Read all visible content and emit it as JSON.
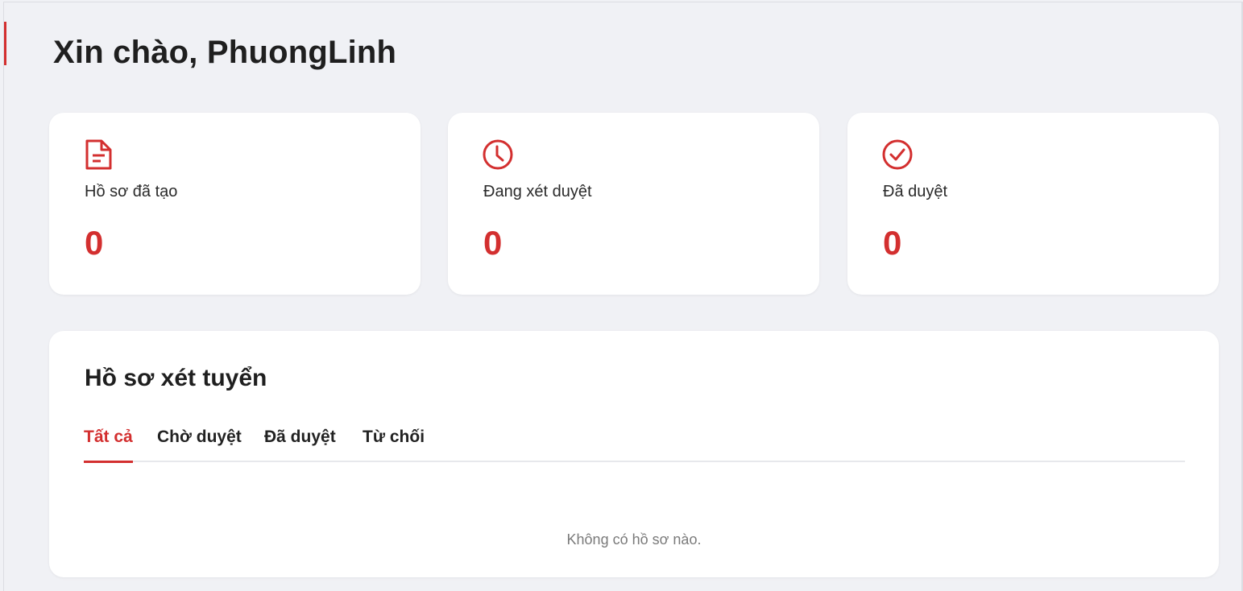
{
  "colors": {
    "accent": "#d32f2f",
    "background": "#f0f1f5"
  },
  "header": {
    "greeting": "Xin chào, PhuongLinh"
  },
  "stats": [
    {
      "icon": "document-icon",
      "label": "Hồ sơ đã tạo",
      "value": "0"
    },
    {
      "icon": "clock-icon",
      "label": "Đang xét duyệt",
      "value": "0"
    },
    {
      "icon": "check-circle-icon",
      "label": "Đã duyệt",
      "value": "0"
    }
  ],
  "applications": {
    "title": "Hồ sơ xét tuyển",
    "tabs": [
      {
        "label": "Tất cả",
        "active": true
      },
      {
        "label": "Chờ duyệt",
        "active": false
      },
      {
        "label": "Đã duyệt",
        "active": false
      },
      {
        "label": "Từ chối",
        "active": false
      }
    ],
    "empty_message": "Không có hồ sơ nào."
  }
}
